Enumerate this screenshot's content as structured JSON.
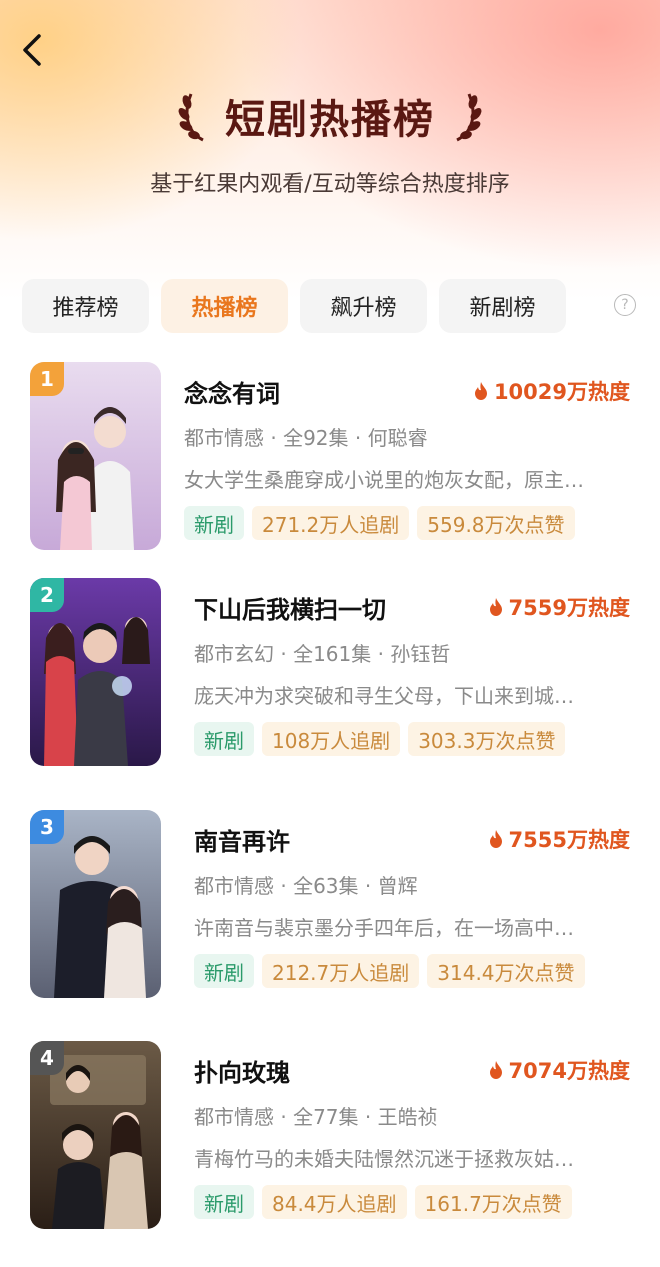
{
  "header": {
    "title": "短剧热播榜",
    "subtitle": "基于红果内观看/互动等综合热度排序"
  },
  "tabs": [
    {
      "label": "推荐榜"
    },
    {
      "label": "热播榜"
    },
    {
      "label": "飙升榜"
    },
    {
      "label": "新剧榜"
    }
  ],
  "help_label": "?",
  "colors": {
    "accent": "#e9771e",
    "heat": "#e0561f",
    "title_dark": "#5a1812",
    "new_tag": "#2a9a6a",
    "stat_tag": "#c98a3c",
    "rank": [
      "#f3a23a",
      "#2fb7a4",
      "#3d8be0",
      "#555555"
    ]
  },
  "items": [
    {
      "rank": "1",
      "title": "念念有词",
      "heat": "10029万热度",
      "meta": "都市情感 · 全92集 · 何聪睿",
      "desc": "女大学生桑鹿穿成小说里的炮灰女配，原主…",
      "tags": {
        "new": "新剧",
        "followers": "271.2万人追剧",
        "likes": "559.8万次点赞"
      }
    },
    {
      "rank": "2",
      "title": "下山后我横扫一切",
      "heat": "7559万热度",
      "meta": "都市玄幻 · 全161集 · 孙钰哲",
      "desc": "庞天冲为求突破和寻生父母，下山来到城…",
      "tags": {
        "new": "新剧",
        "followers": "108万人追剧",
        "likes": "303.3万次点赞"
      }
    },
    {
      "rank": "3",
      "title": "南音再许",
      "heat": "7555万热度",
      "meta": "都市情感 · 全63集 · 曾辉",
      "desc": "许南音与裴京墨分手四年后，在一场高中…",
      "tags": {
        "new": "新剧",
        "followers": "212.7万人追剧",
        "likes": "314.4万次点赞"
      }
    },
    {
      "rank": "4",
      "title": "扑向玫瑰",
      "heat": "7074万热度",
      "meta": "都市情感 · 全77集 · 王皓祯",
      "desc": "青梅竹马的未婚夫陆憬然沉迷于拯救灰姑…",
      "tags": {
        "new": "新剧",
        "followers": "84.4万人追剧",
        "likes": "161.7万次点赞"
      }
    }
  ]
}
